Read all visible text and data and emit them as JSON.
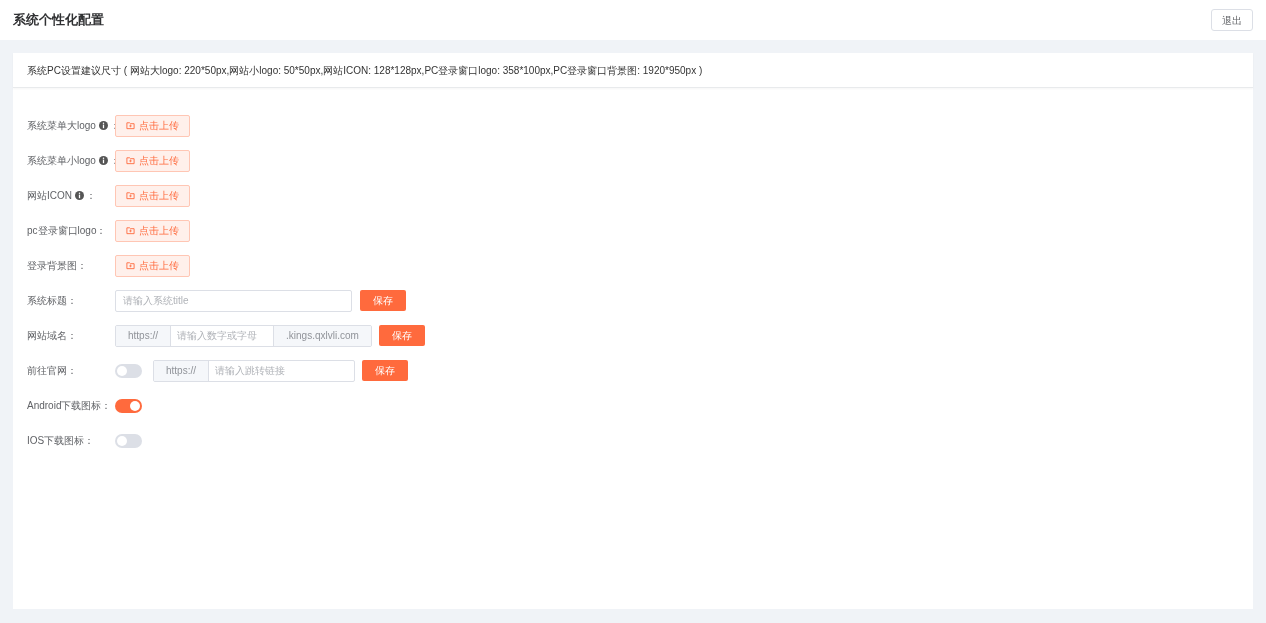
{
  "header": {
    "title": "系统个性化配置",
    "exit_button": "退出"
  },
  "notice": "系统PC设置建议尺寸 ( 网站大logo: 220*50px,网站小logo: 50*50px,网站ICON: 128*128px,PC登录窗口logo: 358*100px,PC登录窗口背景图: 1920*950px )",
  "rows": [
    {
      "kind": "upload",
      "label": "系统菜单大logo",
      "info": true,
      "colon": "：",
      "button": "点击上传"
    },
    {
      "kind": "upload",
      "label": "系统菜单小logo",
      "info": true,
      "colon": "：",
      "button": "点击上传"
    },
    {
      "kind": "upload",
      "label": "网站ICON",
      "info": true,
      "colon": "：",
      "button": "点击上传"
    },
    {
      "kind": "upload",
      "label": "pc登录窗口logo：",
      "info": false,
      "button": "点击上传"
    },
    {
      "kind": "upload",
      "label": "登录背景图：",
      "info": false,
      "button": "点击上传"
    },
    {
      "kind": "text",
      "label": "系统标题：",
      "placeholder": "请输入系统title",
      "button": "保存"
    },
    {
      "kind": "domain",
      "label": "网站域名：",
      "prefix": "https://",
      "placeholder": "请输入数字或字母",
      "suffix": ".kings.qxlvli.com",
      "button": "保存"
    },
    {
      "kind": "link",
      "label": "前往官网：",
      "on": false,
      "prefix": "https://",
      "placeholder": "请输入跳转链接",
      "button": "保存"
    },
    {
      "kind": "switch",
      "label": "Android下载图标：",
      "on": true
    },
    {
      "kind": "switch",
      "label": "IOS下载图标：",
      "on": false
    }
  ]
}
